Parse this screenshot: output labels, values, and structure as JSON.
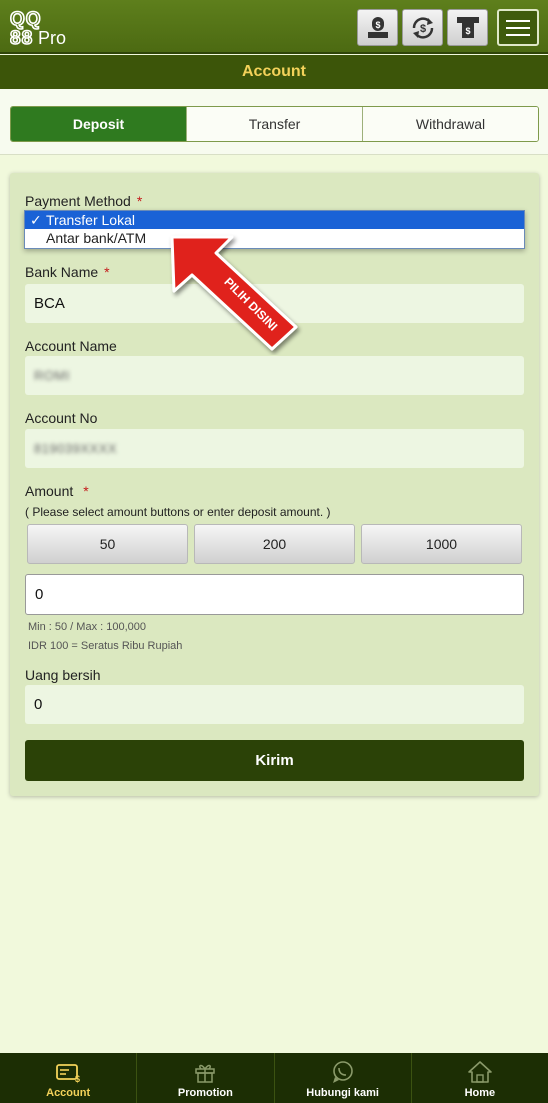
{
  "header": {
    "logo_text": "QQ 88Pro",
    "icons": [
      "deposit-icon",
      "transfer-icon",
      "withdraw-icon",
      "menu-icon"
    ]
  },
  "title": "Account",
  "tabs": [
    {
      "label": "Deposit",
      "active": true
    },
    {
      "label": "Transfer",
      "active": false
    },
    {
      "label": "Withdrawal",
      "active": false
    }
  ],
  "form": {
    "payment_method_label": "Payment Method",
    "required_mark": "*",
    "payment_options": [
      {
        "label": "Transfer Lokal",
        "selected": true
      },
      {
        "label": "Antar bank/ATM",
        "selected": false
      }
    ],
    "bank_name_label": "Bank Name",
    "bank_name_value": "BCA",
    "account_name_label": "Account Name",
    "account_name_value": "ROMI",
    "account_no_label": "Account No",
    "account_no_value": "819039XXXX",
    "amount_label": "Amount",
    "amount_hint": "( Please select amount buttons or enter deposit amount. )",
    "amount_buttons": [
      "50",
      "200",
      "1000"
    ],
    "amount_value": "0",
    "min_max": "Min : 50 / Max : 100,000",
    "idr_note": "IDR 100 = Seratus Ribu Rupiah",
    "net_label": "Uang bersih",
    "net_value": "0",
    "submit_label": "Kirim"
  },
  "annotation": {
    "arrow_text": "PILIH DISINI",
    "color": "#e0201a"
  },
  "bottom_nav": [
    {
      "label": "Account",
      "icon": "account-icon",
      "active": true
    },
    {
      "label": "Promotion",
      "icon": "gift-icon",
      "active": false
    },
    {
      "label": "Hubungi kami",
      "icon": "whatsapp-icon",
      "active": false
    },
    {
      "label": "Home",
      "icon": "home-icon",
      "active": false
    }
  ],
  "colors": {
    "header_green": "#4c6a12",
    "title_bar": "#3c5509",
    "title_text": "#f3d25a",
    "active_tab": "#2f7a1f",
    "card_bg": "#dbe8c0",
    "submit_bg": "#2b4207",
    "nav_bg": "#1c2e04",
    "select_blue": "#1a62d6"
  }
}
